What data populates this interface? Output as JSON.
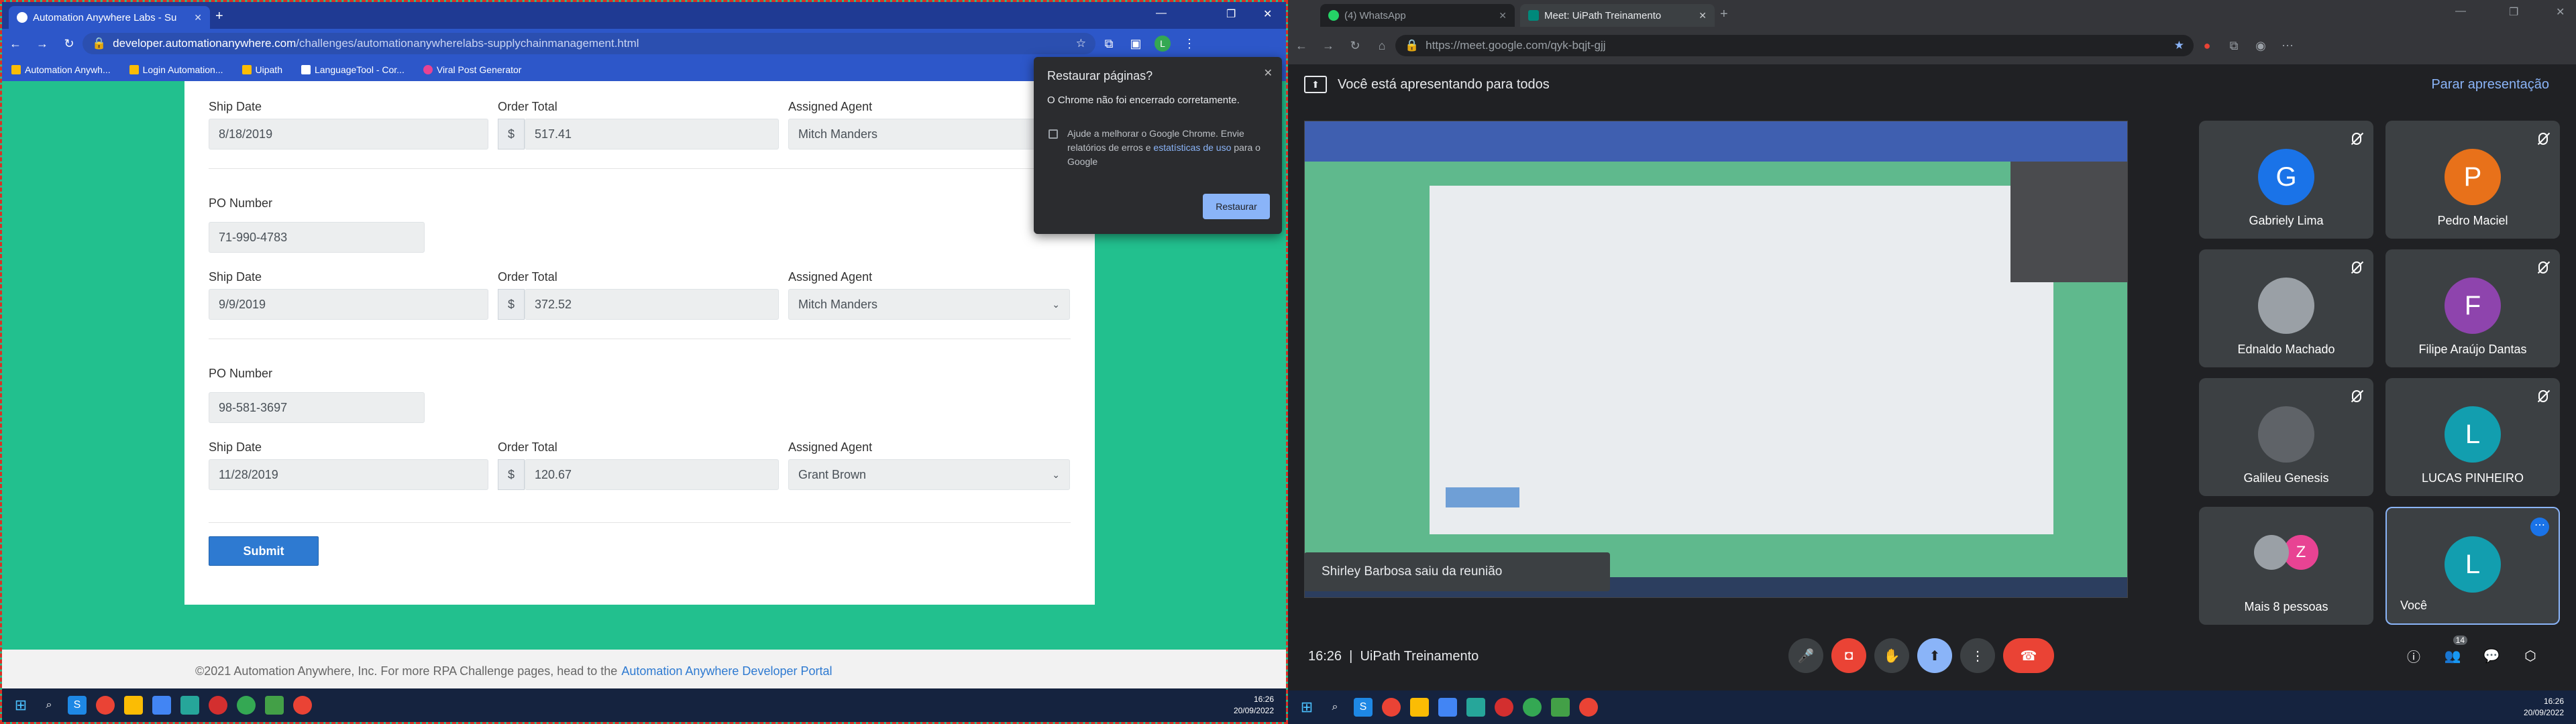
{
  "left_browser": {
    "tab_title": "Automation Anywhere Labs - Su",
    "url_domain": "developer.automationanywhere.com",
    "url_path": "/challenges/automationanywherelabs-supplychainmanagement.html",
    "bookmarks": [
      "Automation Anywh...",
      "Login Automation...",
      "Uipath",
      "LanguageTool - Cor...",
      "Viral Post Generator"
    ]
  },
  "form": {
    "labels": {
      "ship_date": "Ship Date",
      "order_total": "Order Total",
      "assigned_agent": "Assigned Agent",
      "po_number": "PO Number"
    },
    "currency": "$",
    "rows": [
      {
        "po": "",
        "ship_date": "8/18/2019",
        "order_total": "517.41",
        "agent": "Mitch Manders"
      },
      {
        "po": "71-990-4783",
        "ship_date": "9/9/2019",
        "order_total": "372.52",
        "agent": "Mitch Manders"
      },
      {
        "po": "98-581-3697",
        "ship_date": "11/28/2019",
        "order_total": "120.67",
        "agent": "Grant Brown"
      }
    ],
    "submit_label": "Submit"
  },
  "footer": {
    "text": "©2021 Automation Anywhere, Inc. For more RPA Challenge pages, head to the",
    "link": "Automation Anywhere Developer Portal"
  },
  "restore_dialog": {
    "title": "Restaurar páginas?",
    "message": "O Chrome não foi encerrado corretamente.",
    "help_text": "Ajude a melhorar o Google Chrome. Envie relatórios de erros e",
    "help_link": "estatísticas de uso",
    "help_suffix": "para o Google",
    "button": "Restaurar"
  },
  "taskbar": {
    "time": "16:26",
    "date": "20/09/2022"
  },
  "right_browser": {
    "tabs": [
      "(4) WhatsApp",
      "Meet: UiPath Treinamento"
    ],
    "url": "https://meet.google.com/qyk-bqjt-gjj"
  },
  "meet": {
    "presenting_text": "Você está apresentando para todos",
    "stop_label": "Parar apresentação",
    "toast": "Shirley Barbosa saiu da reunião",
    "time": "16:26",
    "meeting_name": "UiPath Treinamento",
    "people_count": "14",
    "participants": [
      {
        "name": "Gabriely Lima",
        "initial": "G",
        "color": "#1a73e8"
      },
      {
        "name": "Pedro Maciel",
        "initial": "P",
        "color": "#e8711a"
      },
      {
        "name": "Ednaldo Machado",
        "initial": "",
        "color": "#9aa0a6"
      },
      {
        "name": "Filipe Araújo Dantas",
        "initial": "F",
        "color": "#8e44ad"
      },
      {
        "name": "Galileu Genesis",
        "initial": "",
        "color": "#5f6368"
      },
      {
        "name": "LUCAS PINHEIRO",
        "initial": "L",
        "color": "#129eaf"
      },
      {
        "name": "Mais 8 pessoas",
        "initial": "Z",
        "color": "#e84393"
      },
      {
        "name": "Você",
        "initial": "L",
        "color": "#129eaf"
      }
    ]
  }
}
